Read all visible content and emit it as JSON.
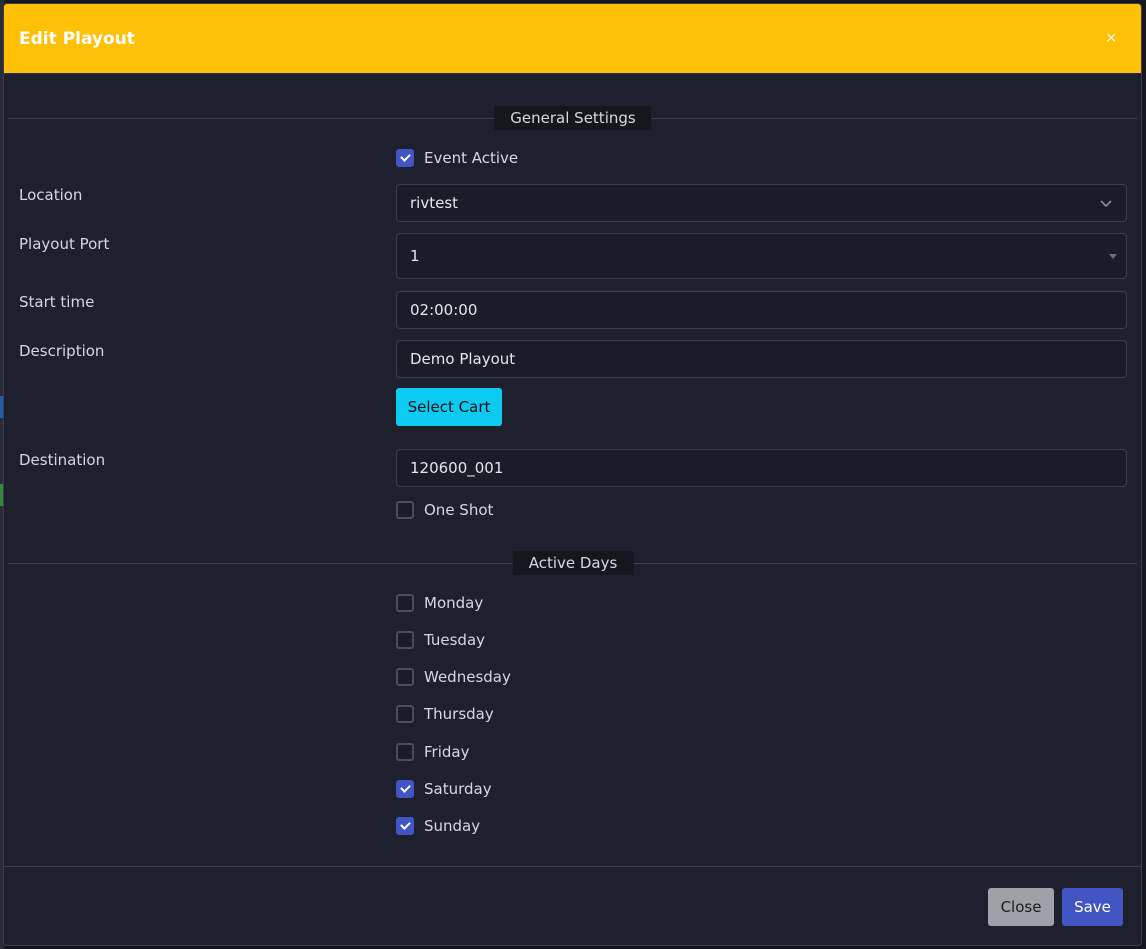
{
  "modal": {
    "title": "Edit Playout",
    "close_glyph": "×",
    "header_color": "#ffc107"
  },
  "general": {
    "legend": "General Settings",
    "event_active": {
      "label": "Event Active",
      "checked": true
    },
    "location": {
      "label": "Location",
      "value": "rivtest"
    },
    "playout_port": {
      "label": "Playout Port",
      "value": "1"
    },
    "start_time": {
      "label": "Start time",
      "value": "02:00:00"
    },
    "description": {
      "label": "Description",
      "value": "Demo Playout"
    },
    "select_cart_label": "Select Cart",
    "destination": {
      "label": "Destination",
      "value": "120600_001"
    },
    "one_shot": {
      "label": "One Shot",
      "checked": false
    }
  },
  "active_days": {
    "legend": "Active Days",
    "days": [
      {
        "label": "Monday",
        "checked": false
      },
      {
        "label": "Tuesday",
        "checked": false
      },
      {
        "label": "Wednesday",
        "checked": false
      },
      {
        "label": "Thursday",
        "checked": false
      },
      {
        "label": "Friday",
        "checked": false
      },
      {
        "label": "Saturday",
        "checked": true
      },
      {
        "label": "Sunday",
        "checked": true
      }
    ]
  },
  "footer": {
    "close_label": "Close",
    "save_label": "Save"
  },
  "colors": {
    "accent": "#4255c4",
    "info_button": "#0dcaf0",
    "secondary_button": "#9ea1a8",
    "panel_bg": "#1f202d"
  }
}
